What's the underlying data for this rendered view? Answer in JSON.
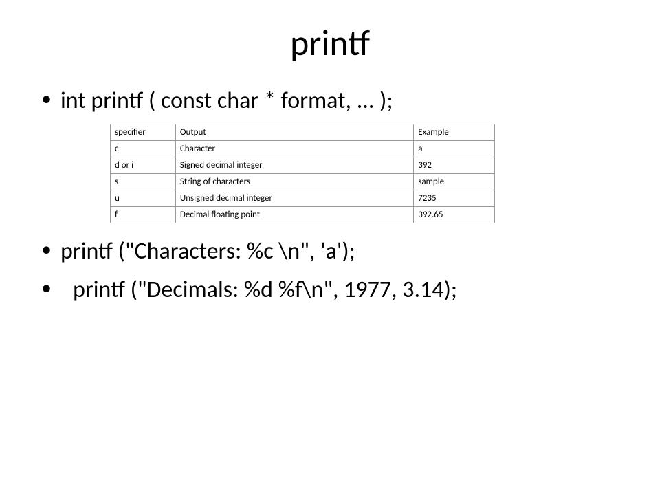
{
  "title": "printf",
  "bullets": {
    "b1": "int printf ( const char * format, ... );",
    "b2": "printf (\"Characters: %c \\n\", 'a');",
    "b3": " printf (\"Decimals: %d %f\\n\", 1977, 3.14);"
  },
  "table": {
    "headers": {
      "specifier": "specifier",
      "output": "Output",
      "example": "Example"
    },
    "rows": [
      {
        "specifier": "c",
        "output": "Character",
        "example": "a"
      },
      {
        "specifier": "d or i",
        "output": "Signed decimal integer",
        "example": "392"
      },
      {
        "specifier": "s",
        "output": "String of characters",
        "example": "sample"
      },
      {
        "specifier": "u",
        "output": "Unsigned decimal integer",
        "example": "7235"
      },
      {
        "specifier": "f",
        "output": "Decimal floating point",
        "example": "392.65"
      }
    ]
  }
}
